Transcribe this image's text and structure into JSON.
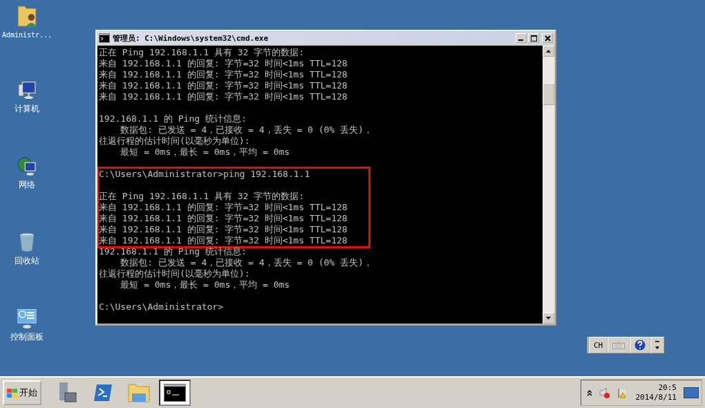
{
  "desktop_icons": [
    {
      "kind": "user-folder",
      "label": "Administr..."
    },
    {
      "kind": "computer",
      "label": "计算机"
    },
    {
      "kind": "network",
      "label": "网络"
    },
    {
      "kind": "recycle-bin",
      "label": "回收站"
    },
    {
      "kind": "control-panel",
      "label": "控制面板"
    }
  ],
  "window": {
    "title": "管理员: C:\\Windows\\system32\\cmd.exe",
    "console_blocks": [
      {
        "blank_line_before": false,
        "highlighted": false,
        "lines": [
          "正在 Ping 192.168.1.1 具有 32 字节的数据:",
          "来自 192.168.1.1 的回复: 字节=32 时间<1ms TTL=128",
          "来自 192.168.1.1 的回复: 字节=32 时间<1ms TTL=128",
          "来自 192.168.1.1 的回复: 字节=32 时间<1ms TTL=128",
          "来自 192.168.1.1 的回复: 字节=32 时间<1ms TTL=128"
        ]
      },
      {
        "blank_line_before": true,
        "highlighted": false,
        "lines": [
          "192.168.1.1 的 Ping 统计信息:",
          "    数据包: 已发送 = 4，已接收 = 4，丢失 = 0 (0% 丢失)，",
          "往返行程的估计时间(以毫秒为单位):",
          "    最短 = 0ms，最长 = 0ms，平均 = 0ms"
        ]
      },
      {
        "blank_line_before": true,
        "highlighted": true,
        "lines": [
          "C:\\Users\\Administrator>ping 192.168.1.1"
        ]
      },
      {
        "blank_line_before": true,
        "highlighted": true,
        "lines": [
          "正在 Ping 192.168.1.1 具有 32 字节的数据:",
          "来自 192.168.1.1 的回复: 字节=32 时间<1ms TTL=128",
          "来自 192.168.1.1 的回复: 字节=32 时间<1ms TTL=128",
          "来自 192.168.1.1 的回复: 字节=32 时间<1ms TTL=128",
          "来自 192.168.1.1 的回复: 字节=32 时间<1ms TTL=128"
        ]
      },
      {
        "blank_line_before": false,
        "highlighted": false,
        "lines": [
          "192.168.1.1 的 Ping 统计信息:",
          "    数据包: 已发送 = 4，已接收 = 4，丢失 = 0 (0% 丢失)，",
          "往返行程的估计时间(以毫秒为单位):",
          "    最短 = 0ms，最长 = 0ms，平均 = 0ms"
        ]
      },
      {
        "blank_line_before": true,
        "highlighted": false,
        "lines": [
          "C:\\Users\\Administrator>"
        ]
      }
    ]
  },
  "language_bar": {
    "language": "CH"
  },
  "taskbar": {
    "start_label": "开始",
    "items": [
      {
        "kind": "server-manager",
        "selected": false
      },
      {
        "kind": "powershell",
        "selected": false
      },
      {
        "kind": "explorer",
        "selected": false
      },
      {
        "kind": "cmd",
        "selected": true
      }
    ],
    "clock": {
      "time": "20:5",
      "date": "2014/8/11"
    }
  }
}
